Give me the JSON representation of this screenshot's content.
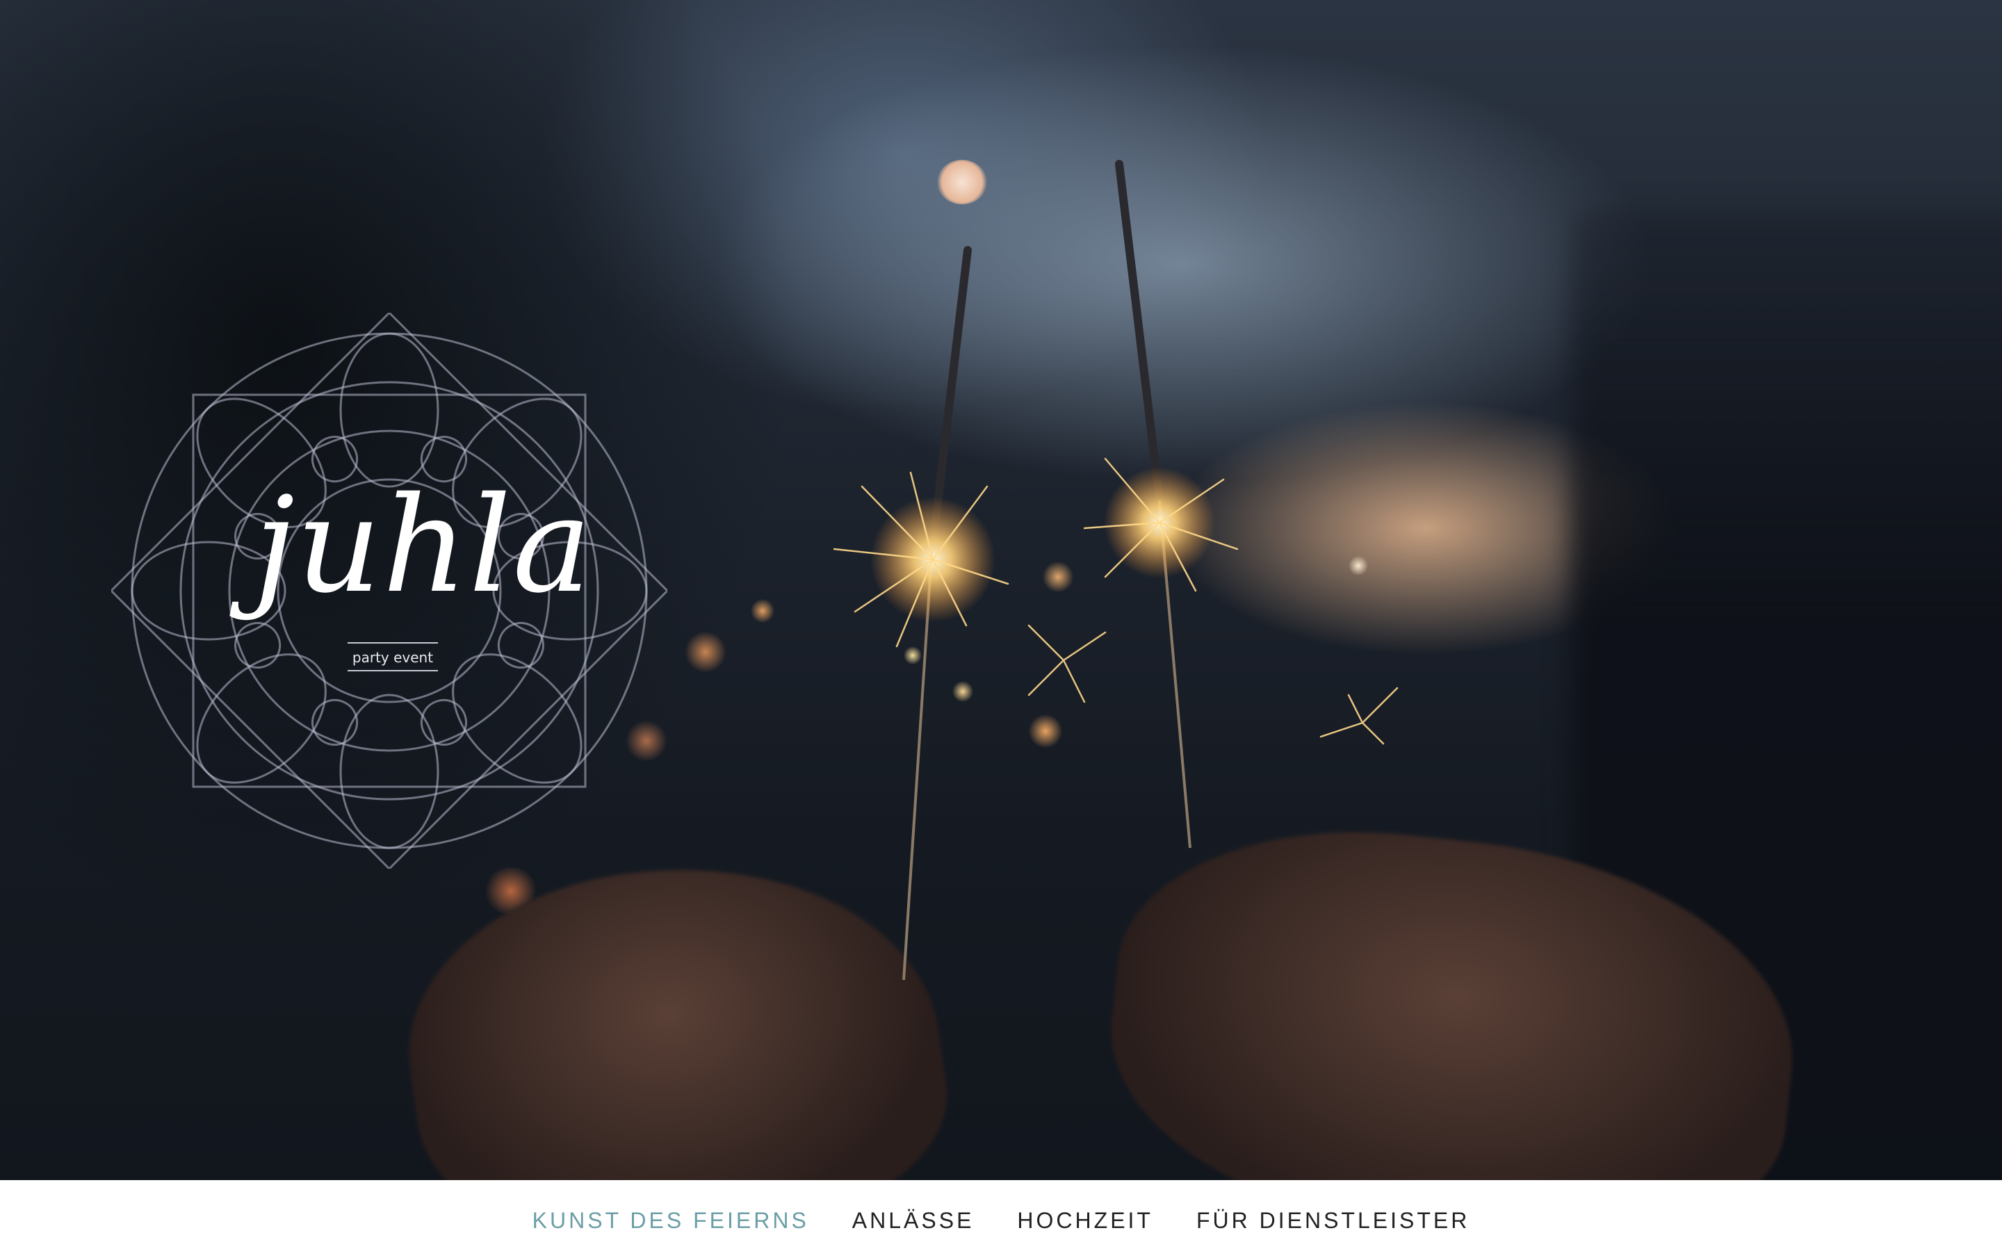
{
  "hero": {
    "logo": {
      "wordmark": "juhla",
      "tagline": "party event"
    }
  },
  "nav": {
    "items": [
      {
        "label": "KUNST DES FEIERNS",
        "active": true
      },
      {
        "label": "ANLÄSSE",
        "active": false
      },
      {
        "label": "HOCHZEIT",
        "active": false
      },
      {
        "label": "FÜR DIENSTLEISTER",
        "active": false
      }
    ],
    "active_color": "#6b9ea6",
    "text_color": "#222222"
  },
  "icons": {
    "logo_ornament": "mandala-icon"
  }
}
